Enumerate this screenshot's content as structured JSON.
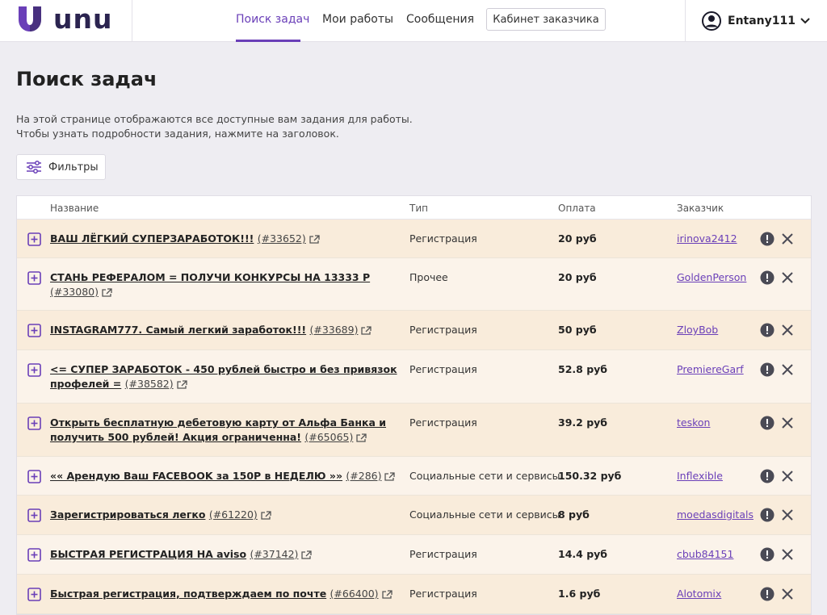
{
  "brand": {
    "name": "unu",
    "accent": "#6a3fb8",
    "logo_color": "#2b2450"
  },
  "nav": {
    "search": "Поиск задач",
    "my_works": "Мои работы",
    "messages": "Сообщения",
    "cabinet": "Кабинет заказчика"
  },
  "user": {
    "name": "Entany111",
    "avatar_icon": "user-circle-icon",
    "menu_icon": "chevron-down-icon"
  },
  "page": {
    "title": "Поиск задач",
    "desc_line1": "На этой странице отображаются все доступные вам задания для работы.",
    "desc_line2": "Чтобы узнать подробности задания, нажмите на заголовок.",
    "filters": "Фильтры"
  },
  "table": {
    "headers": {
      "name": "Название",
      "type": "Тип",
      "pay": "Оплата",
      "customer": "Заказчик"
    },
    "rows": [
      {
        "title": "ВАШ ЛЁГКИЙ СУПЕРЗАРАБОТОК!!!",
        "id": "(#33652)",
        "type": "Регистрация",
        "pay": "20 руб",
        "customer": "irinova2412"
      },
      {
        "title": "СТАНЬ РЕФЕРАЛОМ = ПОЛУЧИ КОНКУРСЫ НА 13333 Р",
        "id": "(#33080)",
        "type": "Прочее",
        "pay": "20 руб",
        "customer": "GoldenPerson"
      },
      {
        "title": "INSTAGRAM777. Самый легкий заработок!!!",
        "id": "(#33689)",
        "type": "Регистрация",
        "pay": "50 руб",
        "customer": "ZloyBob"
      },
      {
        "title": "<= СУПЕР ЗАРАБОТОК - 450 рублей быстро и без привязок профелей =",
        "id": "(#38582)",
        "type": "Регистрация",
        "pay": "52.8 руб",
        "customer": "PremiereGarf"
      },
      {
        "title": "Открыть бесплатную дебетовую карту от Альфа Банка и получить 500 рублей! Акция ограниченна!",
        "id": "(#65065)",
        "type": "Регистрация",
        "pay": "39.2 руб",
        "customer": "teskon"
      },
      {
        "title": "«« Арендую Ваш FACEBOOK за 150Р в НЕДЕЛЮ »»",
        "id": "(#286)",
        "type": "Социальные сети и сервисы",
        "pay": "150.32 руб",
        "customer": "Inflexible"
      },
      {
        "title": "Зарегистрироваться легко",
        "id": "(#61220)",
        "type": "Социальные сети и сервисы",
        "pay": "8 руб",
        "customer": "moedasdigitals"
      },
      {
        "title": "БЫСТРАЯ РЕГИСТРАЦИЯ НА aviso",
        "id": "(#37142)",
        "type": "Регистрация",
        "pay": "14.4 руб",
        "customer": "cbub84151"
      },
      {
        "title": "Быстрая регистрация, подтверждаем по почте",
        "id": "(#66400)",
        "type": "Регистрация",
        "pay": "1.6 руб",
        "customer": "Alotomix"
      }
    ]
  }
}
